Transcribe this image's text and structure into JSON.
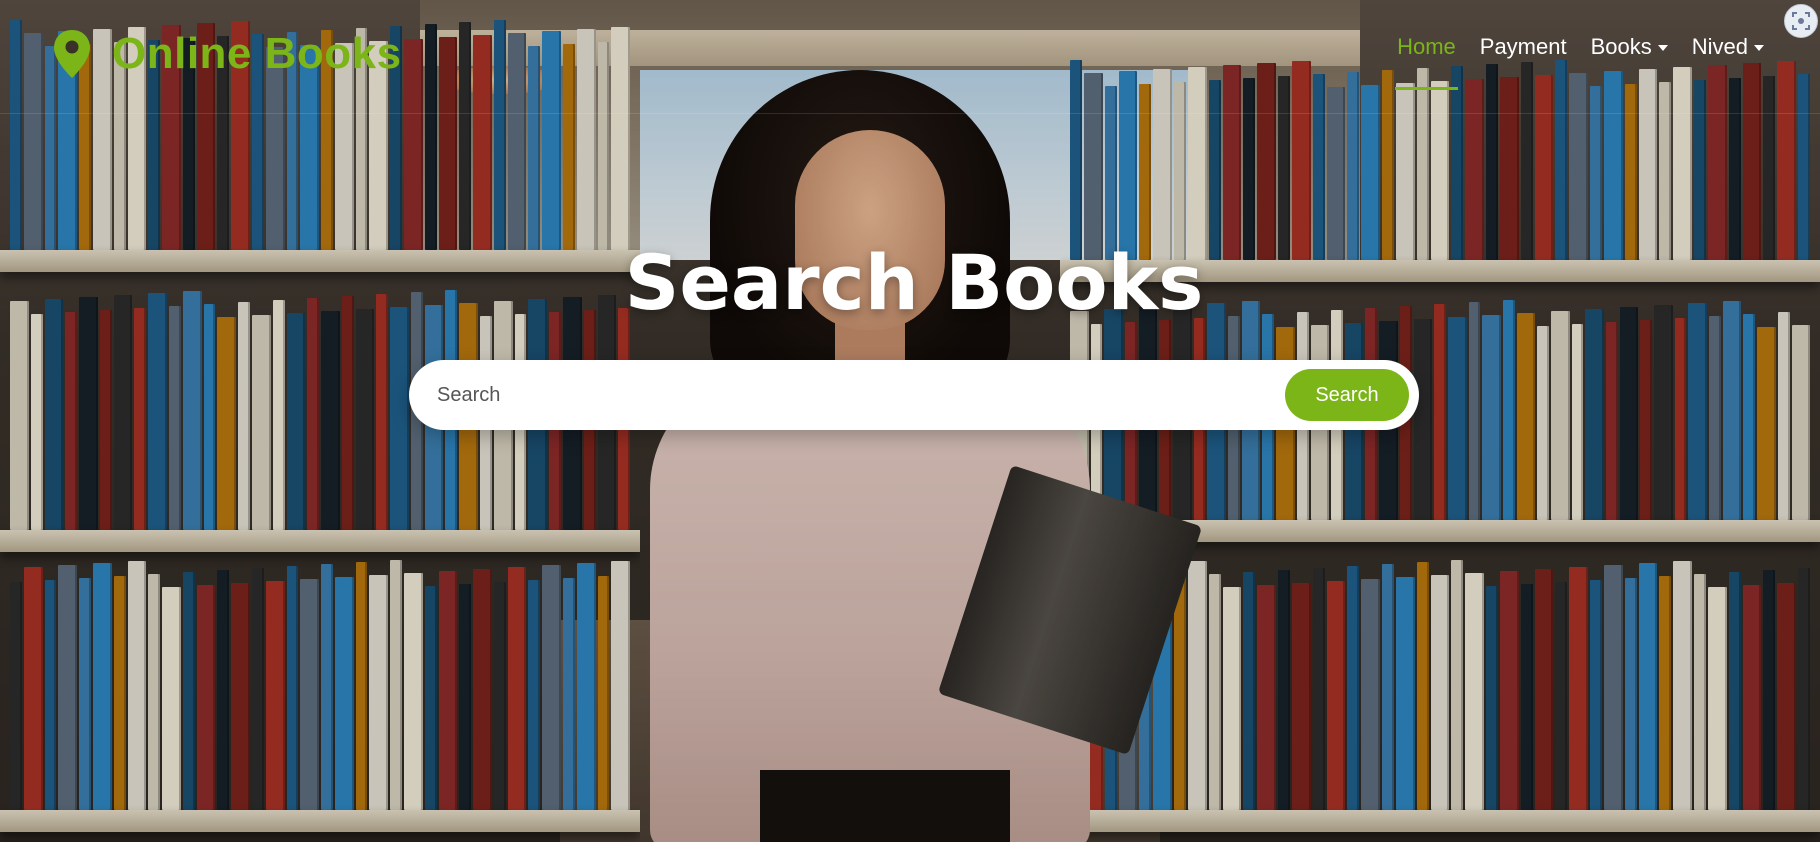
{
  "navbar": {
    "brand": {
      "name": "Online Books",
      "icon": "map-pin-icon"
    },
    "links": [
      {
        "label": "Home",
        "active": true,
        "dropdown": false
      },
      {
        "label": "Payment",
        "active": false,
        "dropdown": false
      },
      {
        "label": "Books",
        "active": false,
        "dropdown": true
      },
      {
        "label": "Nived",
        "active": false,
        "dropdown": true
      }
    ]
  },
  "hero": {
    "title": "Search Books",
    "search": {
      "placeholder": "Search",
      "value": "",
      "button_label": "Search"
    }
  },
  "corner_widget": {
    "icon": "screen-capture-icon"
  },
  "colors": {
    "accent": "#7cb518",
    "nav_text": "#ffffff",
    "search_bg": "#ffffff"
  }
}
